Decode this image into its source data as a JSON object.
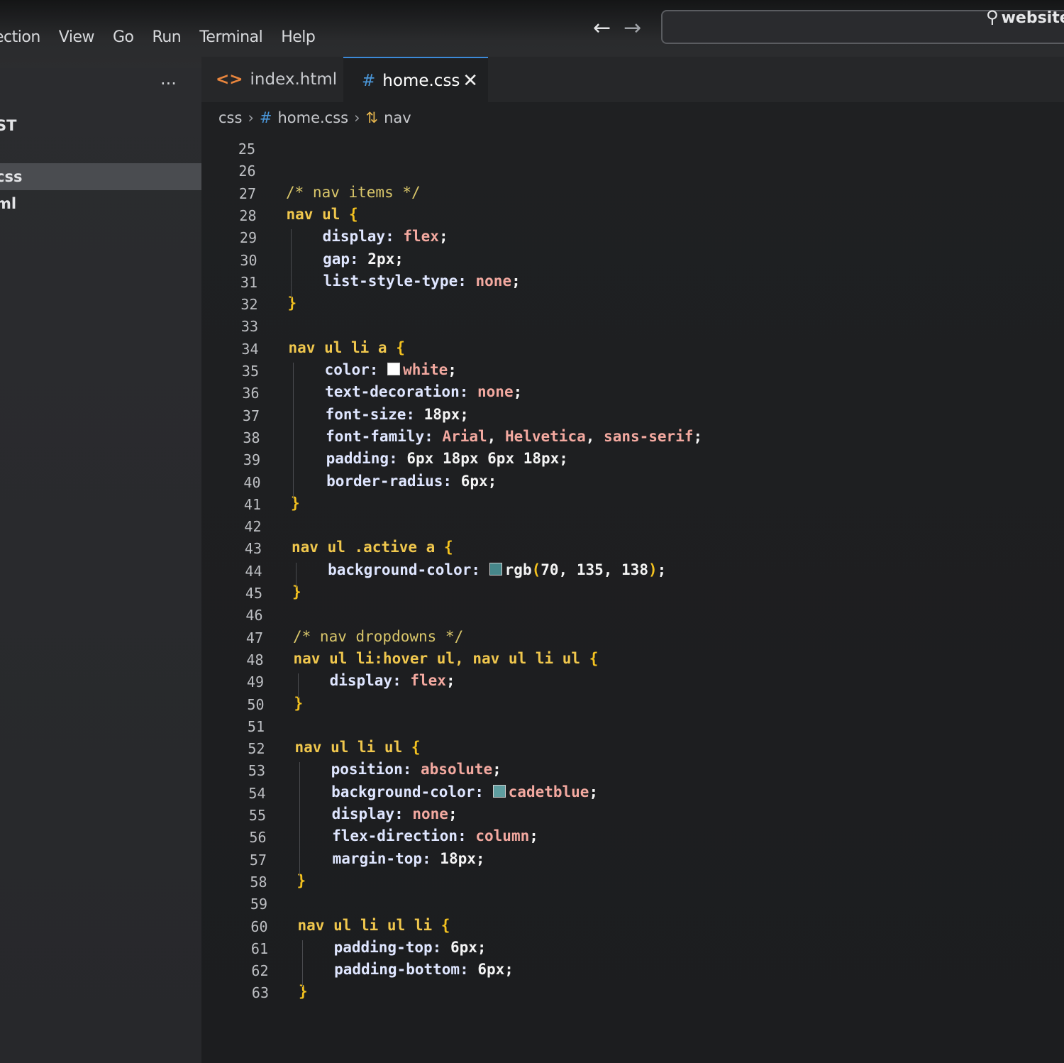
{
  "menu": [
    "ection",
    "View",
    "Go",
    "Run",
    "Terminal",
    "Help"
  ],
  "nav": {
    "back_icon": "arrow-left-icon",
    "forward_icon": "arrow-right-icon"
  },
  "search": {
    "icon": "search-icon",
    "text": "website_"
  },
  "sidebar": {
    "more_label": "···",
    "items": [
      "ST",
      "css",
      "ml"
    ],
    "selected_index": 1
  },
  "tabs": [
    {
      "label": "index.html",
      "icon": "html-file-icon",
      "active": false
    },
    {
      "label": "home.css",
      "icon": "css-file-icon",
      "active": true,
      "close_label": "✕"
    }
  ],
  "breadcrumb": [
    "css",
    "home.css",
    "nav"
  ],
  "colors": {
    "accent": "#3c8ad8",
    "swatch_white": "#ffffff",
    "swatch_teal": "#46878a",
    "swatch_cadetblue": "#5f9ea0"
  },
  "lines": [
    {
      "n": "25",
      "t": []
    },
    {
      "n": "26",
      "t": []
    },
    {
      "n": "27",
      "t": [
        [
          "comment",
          "/* nav items */"
        ]
      ]
    },
    {
      "n": "28",
      "t": [
        [
          "selector",
          "nav ul "
        ],
        [
          "brace",
          "{"
        ]
      ]
    },
    {
      "n": "29",
      "t": [
        [
          "prop",
          "    display: "
        ],
        [
          "value",
          "flex"
        ],
        [
          "num",
          ";"
        ]
      ]
    },
    {
      "n": "30",
      "t": [
        [
          "prop",
          "    gap: "
        ],
        [
          "num",
          "2px;"
        ]
      ]
    },
    {
      "n": "31",
      "t": [
        [
          "prop",
          "    list-style-type: "
        ],
        [
          "value",
          "none"
        ],
        [
          "num",
          ";"
        ]
      ]
    },
    {
      "n": "32",
      "t": [
        [
          "brace",
          "}"
        ]
      ]
    },
    {
      "n": "33",
      "t": []
    },
    {
      "n": "34",
      "t": [
        [
          "selector",
          "nav ul li a "
        ],
        [
          "brace",
          "{"
        ]
      ]
    },
    {
      "n": "35",
      "t": [
        [
          "prop",
          "    color: "
        ],
        [
          "swatch",
          "#ffffff"
        ],
        [
          "value",
          "white"
        ],
        [
          "num",
          ";"
        ]
      ]
    },
    {
      "n": "36",
      "t": [
        [
          "prop",
          "    text-decoration: "
        ],
        [
          "value",
          "none"
        ],
        [
          "num",
          ";"
        ]
      ]
    },
    {
      "n": "37",
      "t": [
        [
          "prop",
          "    font-size: "
        ],
        [
          "num",
          "18px;"
        ]
      ]
    },
    {
      "n": "38",
      "t": [
        [
          "prop",
          "    font-family: "
        ],
        [
          "value",
          "Arial"
        ],
        [
          "num",
          ", "
        ],
        [
          "value",
          "Helvetica"
        ],
        [
          "num",
          ", "
        ],
        [
          "value",
          "sans-serif"
        ],
        [
          "num",
          ";"
        ]
      ]
    },
    {
      "n": "39",
      "t": [
        [
          "prop",
          "    padding: "
        ],
        [
          "num",
          "6px 18px 6px 18px;"
        ]
      ]
    },
    {
      "n": "40",
      "t": [
        [
          "prop",
          "    border-radius: "
        ],
        [
          "num",
          "6px;"
        ]
      ]
    },
    {
      "n": "41",
      "t": [
        [
          "brace",
          "}"
        ]
      ]
    },
    {
      "n": "42",
      "t": []
    },
    {
      "n": "43",
      "t": [
        [
          "selector",
          "nav ul .active a "
        ],
        [
          "brace",
          "{"
        ]
      ]
    },
    {
      "n": "44",
      "t": [
        [
          "prop",
          "    background-color: "
        ],
        [
          "swatch",
          "#46878a"
        ],
        [
          "num",
          "rgb"
        ],
        [
          "brace",
          "("
        ],
        [
          "num",
          "70, 135, 138"
        ],
        [
          "brace",
          ")"
        ],
        [
          "num",
          ";"
        ]
      ]
    },
    {
      "n": "45",
      "t": [
        [
          "brace",
          "}"
        ]
      ]
    },
    {
      "n": "46",
      "t": []
    },
    {
      "n": "47",
      "t": [
        [
          "comment",
          "/* nav dropdowns */"
        ]
      ]
    },
    {
      "n": "48",
      "t": [
        [
          "selector",
          "nav ul li:hover ul, nav ul li ul "
        ],
        [
          "brace",
          "{"
        ]
      ]
    },
    {
      "n": "49",
      "t": [
        [
          "prop",
          "    display: "
        ],
        [
          "value",
          "flex"
        ],
        [
          "num",
          ";"
        ]
      ]
    },
    {
      "n": "50",
      "t": [
        [
          "brace",
          "}"
        ]
      ]
    },
    {
      "n": "51",
      "t": []
    },
    {
      "n": "52",
      "t": [
        [
          "selector",
          "nav ul li ul "
        ],
        [
          "brace",
          "{"
        ]
      ]
    },
    {
      "n": "53",
      "t": [
        [
          "prop",
          "    position: "
        ],
        [
          "value",
          "absolute"
        ],
        [
          "num",
          ";"
        ]
      ]
    },
    {
      "n": "54",
      "t": [
        [
          "prop",
          "    background-color: "
        ],
        [
          "swatch",
          "#5f9ea0"
        ],
        [
          "value",
          "cadetblue"
        ],
        [
          "num",
          ";"
        ]
      ]
    },
    {
      "n": "55",
      "t": [
        [
          "prop",
          "    display: "
        ],
        [
          "value",
          "none"
        ],
        [
          "num",
          ";"
        ]
      ]
    },
    {
      "n": "56",
      "t": [
        [
          "prop",
          "    flex-direction: "
        ],
        [
          "value",
          "column"
        ],
        [
          "num",
          ";"
        ]
      ]
    },
    {
      "n": "57",
      "t": [
        [
          "prop",
          "    margin-top: "
        ],
        [
          "num",
          "18px;"
        ]
      ]
    },
    {
      "n": "58",
      "t": [
        [
          "brace",
          "}"
        ]
      ]
    },
    {
      "n": "59",
      "t": []
    },
    {
      "n": "60",
      "t": [
        [
          "selector",
          "nav ul li ul li "
        ],
        [
          "brace",
          "{"
        ]
      ]
    },
    {
      "n": "61",
      "t": [
        [
          "prop",
          "    padding-top: "
        ],
        [
          "num",
          "6px;"
        ]
      ]
    },
    {
      "n": "62",
      "t": [
        [
          "prop",
          "    padding-bottom: "
        ],
        [
          "num",
          "6px;"
        ]
      ]
    },
    {
      "n": "63",
      "t": [
        [
          "brace",
          "}"
        ]
      ]
    }
  ]
}
